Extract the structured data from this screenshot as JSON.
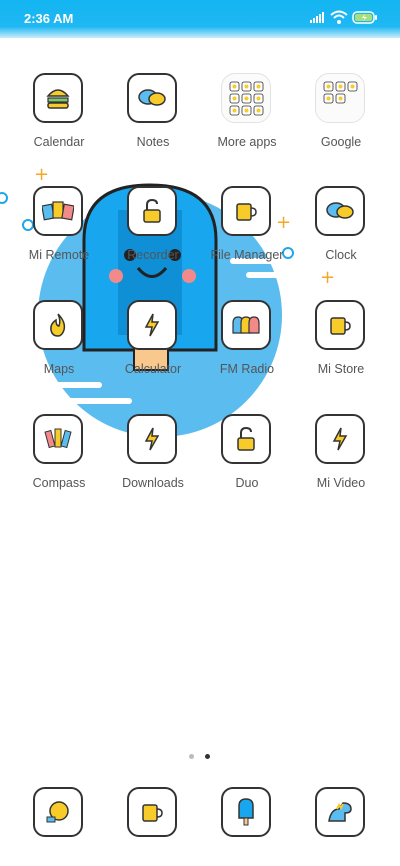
{
  "status_bar": {
    "time": "2:36 AM"
  },
  "apps": [
    {
      "label": "Calendar",
      "icon": "burger-icon"
    },
    {
      "label": "Notes",
      "icon": "chat-bubbles-icon"
    },
    {
      "label": "More apps",
      "icon": "folder-grid-icon"
    },
    {
      "label": "Google",
      "icon": "folder-grid-icon"
    },
    {
      "label": "Mi Remote",
      "icon": "cards-icon"
    },
    {
      "label": "Recorder",
      "icon": "padlock-icon"
    },
    {
      "label": "File Manager",
      "icon": "mug-icon"
    },
    {
      "label": "Clock",
      "icon": "chat-bubbles-icon"
    },
    {
      "label": "Maps",
      "icon": "flame-icon"
    },
    {
      "label": "Calculator",
      "icon": "lightning-icon"
    },
    {
      "label": "FM Radio",
      "icon": "ghosts-icon"
    },
    {
      "label": "Mi Store",
      "icon": "mug-icon"
    },
    {
      "label": "Compass",
      "icon": "crayons-icon"
    },
    {
      "label": "Downloads",
      "icon": "lightning-icon"
    },
    {
      "label": "Duo",
      "icon": "padlock-icon"
    },
    {
      "label": "Mi Video",
      "icon": "lightning-icon"
    }
  ],
  "page_indicator": {
    "pages": 2,
    "active": 2
  },
  "dock": [
    {
      "icon": "speech-bubble-icon"
    },
    {
      "icon": "mug-icon"
    },
    {
      "icon": "popsicle-icon"
    },
    {
      "icon": "dinosaur-icon"
    }
  ],
  "colors": {
    "accent": "#12b5f2",
    "icon_yellow": "#f7cc2a",
    "outline": "#333333"
  }
}
